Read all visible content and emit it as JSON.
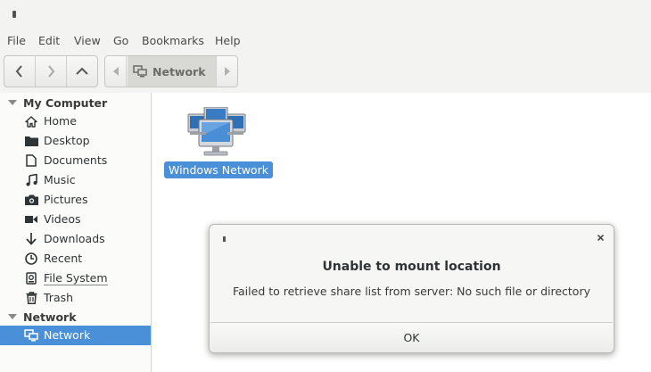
{
  "menubar": {
    "items": [
      "File",
      "Edit",
      "View",
      "Go",
      "Bookmarks",
      "Help"
    ]
  },
  "toolbar": {
    "nav": [
      "back-icon",
      "forward-icon",
      "up-icon"
    ],
    "path": {
      "current": "Network"
    }
  },
  "sidebar": {
    "sections": [
      {
        "label": "My Computer",
        "items": [
          {
            "label": "Home",
            "icon": "home-icon"
          },
          {
            "label": "Desktop",
            "icon": "desktop-folder-icon"
          },
          {
            "label": "Documents",
            "icon": "document-icon"
          },
          {
            "label": "Music",
            "icon": "music-icon"
          },
          {
            "label": "Pictures",
            "icon": "camera-icon"
          },
          {
            "label": "Videos",
            "icon": "video-icon"
          },
          {
            "label": "Downloads",
            "icon": "download-icon"
          },
          {
            "label": "Recent",
            "icon": "clock-icon"
          },
          {
            "label": "File System",
            "icon": "drive-icon"
          },
          {
            "label": "Trash",
            "icon": "trash-icon"
          }
        ]
      },
      {
        "label": "Network",
        "items": [
          {
            "label": "Network",
            "icon": "network-icon",
            "active": true
          }
        ]
      }
    ]
  },
  "content": {
    "items": [
      {
        "label": "Windows Network",
        "icon": "windows-network-icon",
        "selected": true
      }
    ]
  },
  "dialog": {
    "title": "Unable to mount location",
    "message": "Failed to retrieve share list from server: No such file or directory",
    "ok_label": "OK"
  },
  "colors": {
    "accent": "#4a90d9"
  }
}
